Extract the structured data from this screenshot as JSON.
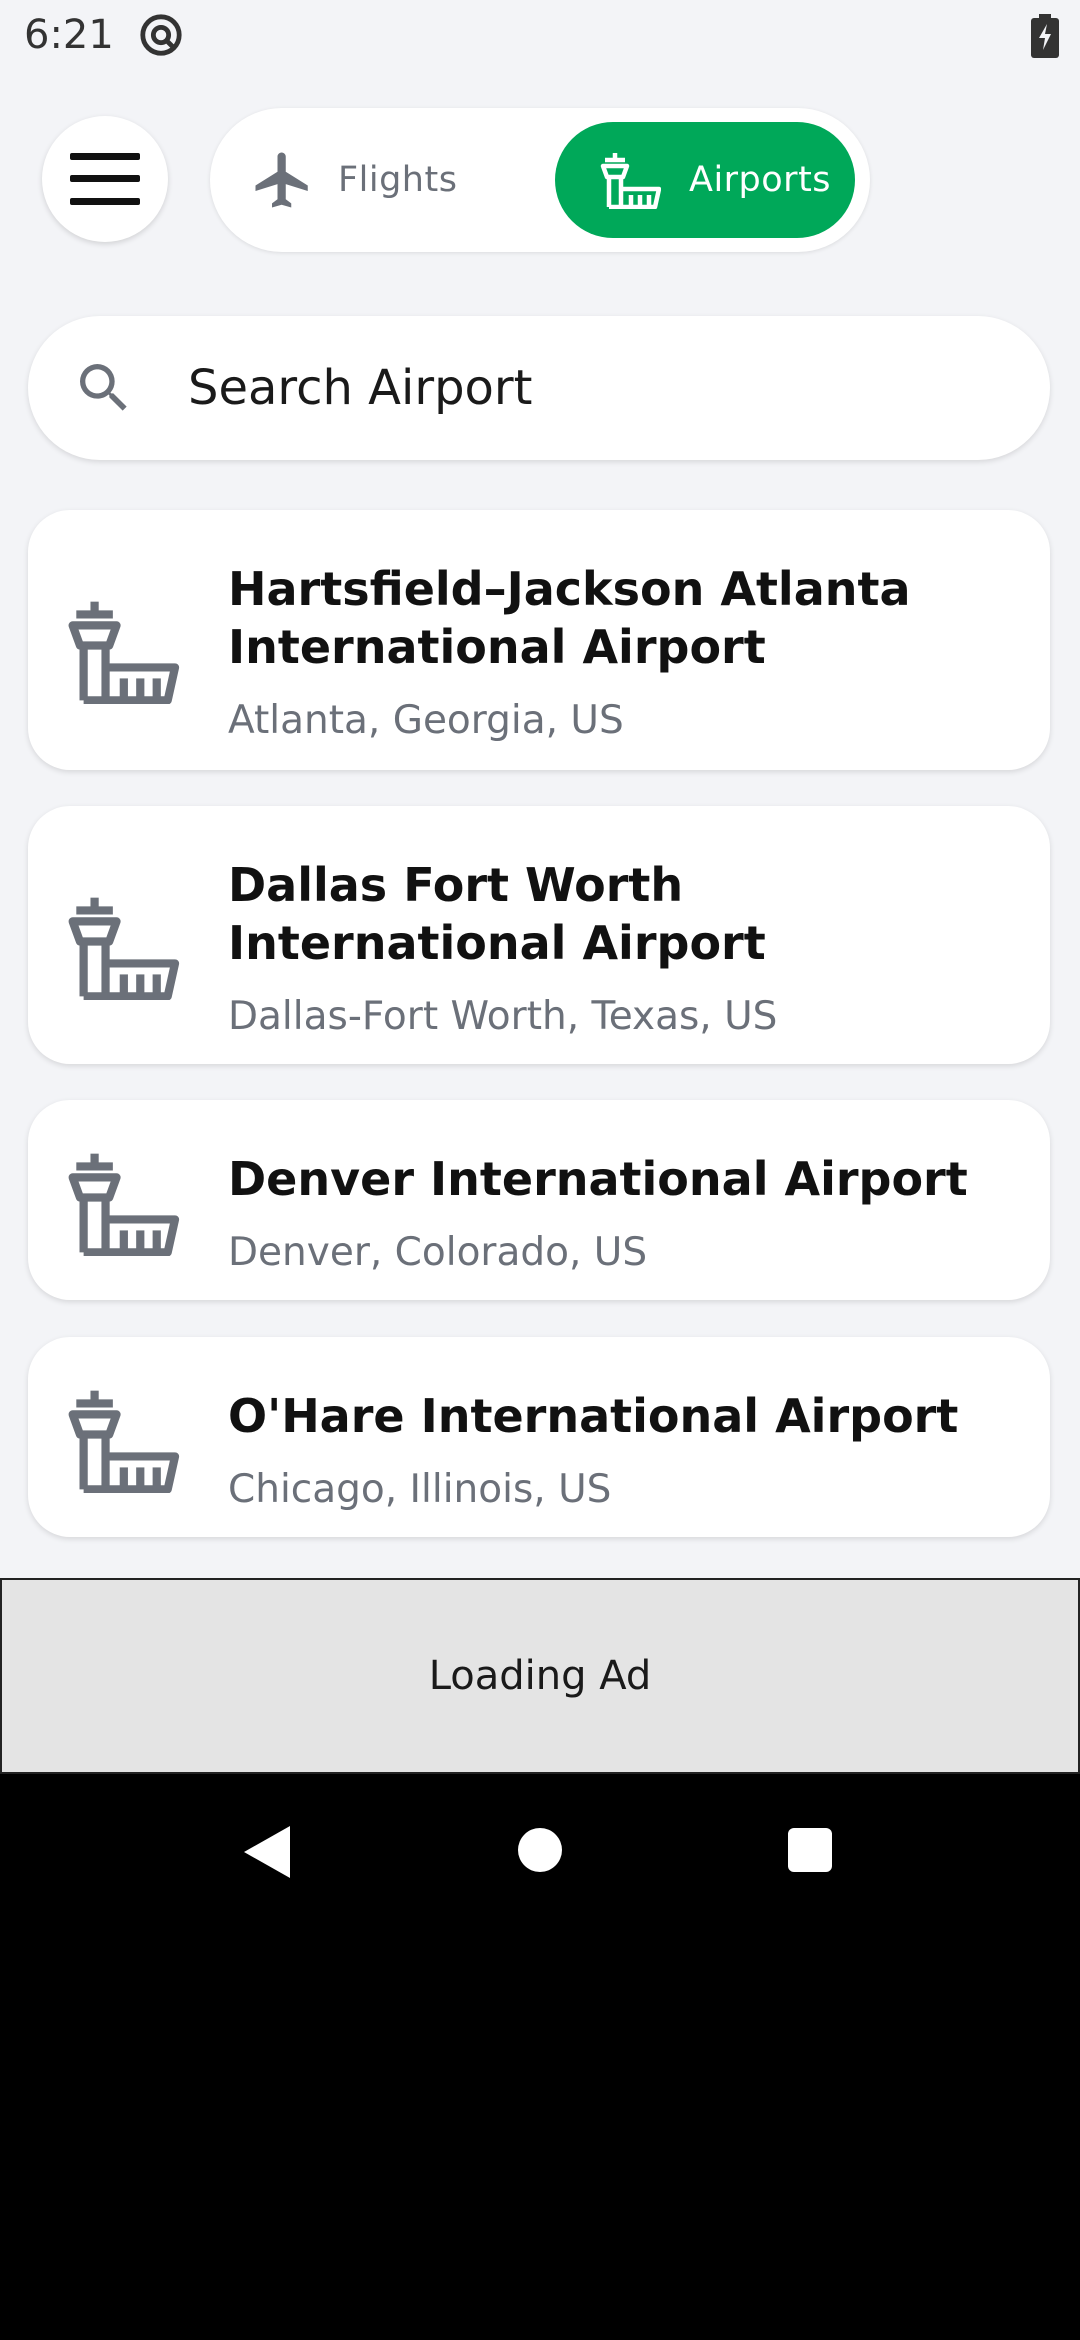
{
  "status_bar": {
    "time": "6:21"
  },
  "header": {
    "menu_icon": "hamburger-menu-icon",
    "tabs": [
      {
        "label": "Flights",
        "icon": "airplane-icon",
        "active": false
      },
      {
        "label": "Airports",
        "icon": "control-tower-icon",
        "active": true
      }
    ]
  },
  "search": {
    "placeholder": "Search Airport",
    "value": ""
  },
  "airports": [
    {
      "name": "Hartsfield–Jackson Atlanta International Airport",
      "location": "Atlanta, Georgia, US"
    },
    {
      "name": "Dallas Fort Worth International Airport",
      "location": "Dallas-Fort Worth, Texas, US"
    },
    {
      "name": "Denver International Airport",
      "location": "Denver, Colorado, US"
    },
    {
      "name": "O'Hare International Airport",
      "location": "Chicago, Illinois, US"
    }
  ],
  "ad": {
    "text": "Loading Ad"
  },
  "colors": {
    "accent": "#00a859",
    "background": "#f3f4f7",
    "icon_gray": "#6b7079"
  }
}
